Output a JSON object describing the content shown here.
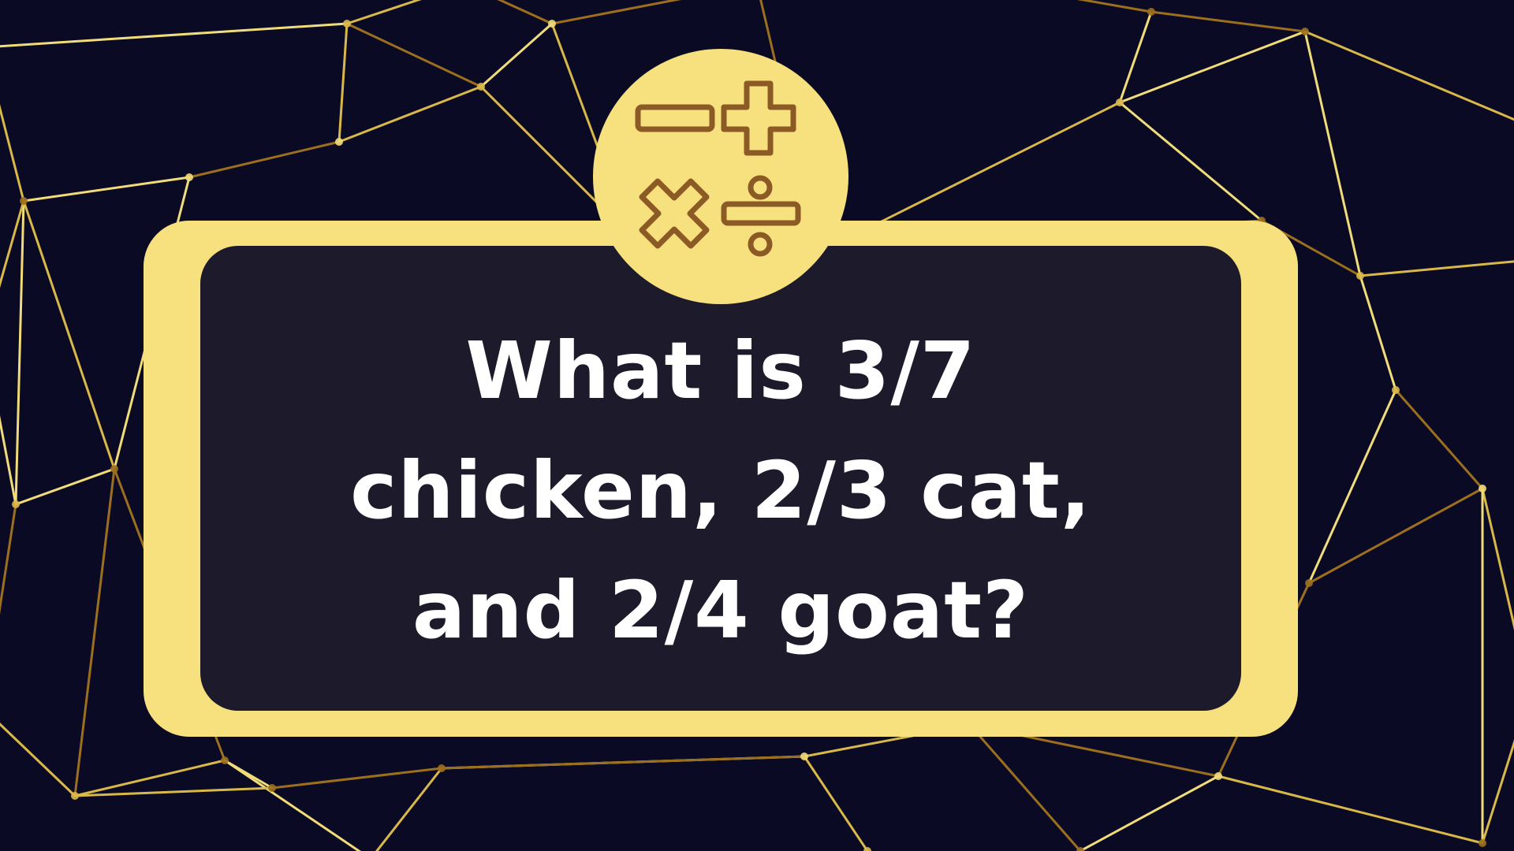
{
  "colors": {
    "background": "#0b0a24",
    "line_gold": "#d9b84a",
    "line_gold_light": "#f0dc7a",
    "line_gold_dark": "#9c6f1f",
    "card_frame": "#f7e17f",
    "card_panel": "#1d1a2b",
    "badge_fill": "#f7e17f",
    "icon_stroke": "#8b5a25",
    "text": "#ffffff"
  },
  "badge": {
    "icons": [
      "minus-icon",
      "plus-icon",
      "multiply-icon",
      "divide-icon"
    ]
  },
  "question": {
    "lines": [
      "What is 3/7",
      "chicken, 2/3 cat,",
      "and 2/4 goat?"
    ]
  }
}
